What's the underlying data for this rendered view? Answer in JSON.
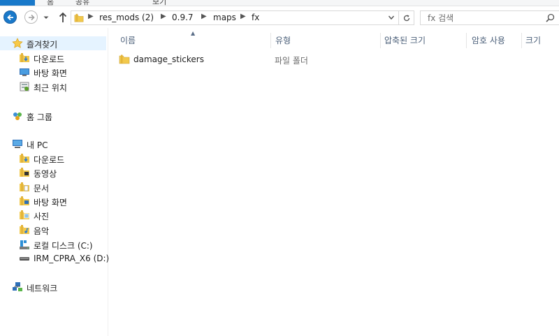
{
  "ribbon": {
    "tabs": [
      "파일",
      "홈",
      "공유",
      "보기"
    ]
  },
  "address_bar": {
    "crumbs": [
      "res_mods (2)",
      "0.9.7",
      "maps",
      "fx"
    ]
  },
  "search": {
    "placeholder": "fx 검색"
  },
  "nav_pane": {
    "favorites": {
      "label": "즐겨찾기",
      "items": [
        "다운로드",
        "바탕 화면",
        "최근 위치"
      ]
    },
    "homegroup": {
      "label": "홈 그룹"
    },
    "this_pc": {
      "label": "내 PC",
      "items": [
        "다운로드",
        "동영상",
        "문서",
        "바탕 화면",
        "사진",
        "음악",
        "로컬 디스크 (C:)",
        "IRM_CPRA_X6 (D:)"
      ]
    },
    "network": {
      "label": "네트워크"
    }
  },
  "columns": [
    "이름",
    "유형",
    "압축된 크기",
    "암호 사용",
    "크기"
  ],
  "files": [
    {
      "name": "damage_stickers",
      "type": "파일 폴더"
    }
  ],
  "colors": {
    "accent": "#1979ca",
    "selection": "#e5f3ff",
    "folder": "#f2c94c",
    "header_text": "#4c607a"
  }
}
